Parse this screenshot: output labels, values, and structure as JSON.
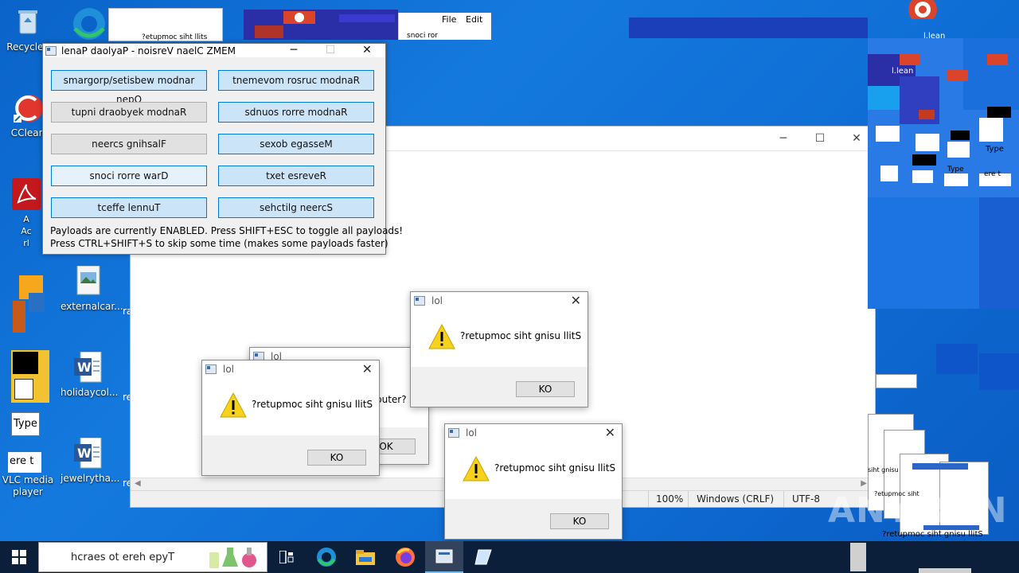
{
  "desktop": {
    "icons": [
      {
        "label": "Recycle I"
      },
      {
        "label": "CClean"
      },
      {
        "label": "A\nAc\nrl"
      },
      {
        "label": "externalcar..."
      },
      {
        "label": "holidaycol..."
      },
      {
        "label": "jewelrytha..."
      },
      {
        "label": "VLC media player"
      }
    ],
    "fragments": {
      "type1": "Type",
      "here1": "ere t",
      "ra": "ra",
      "re1": "re",
      "re2": "re"
    }
  },
  "notepad_bg": {
    "menu_file": "File",
    "menu_edit": "Edit",
    "status_zoom": "100%",
    "status_eol": "Windows (CRLF)",
    "status_enc": "UTF-8"
  },
  "panel": {
    "title": "lenaP daolyaP - noisreV naelC ZMEM",
    "buttons": [
      {
        "label": "smargorp/setisbew modnar nepO",
        "style": "blue"
      },
      {
        "label": "tnemevom rosruc modnaR",
        "style": "blue"
      },
      {
        "label": "tupni draobyek modnaR",
        "style": "gray"
      },
      {
        "label": "sdnuos rorre modnaR",
        "style": "blue"
      },
      {
        "label": "neercs gnihsalF",
        "style": "gray"
      },
      {
        "label": "sexob egasseM",
        "style": "blue"
      },
      {
        "label": "snoci rorre warD",
        "style": "light"
      },
      {
        "label": "txet esreveR",
        "style": "blue"
      },
      {
        "label": "tceffe lennuT",
        "style": "blue"
      },
      {
        "label": "sehctilg neercS",
        "style": "blue"
      }
    ],
    "info1": "Payloads are currently ENABLED. Press SHIFT+ESC to toggle all payloads!",
    "info2": "Press CTRL+SHIFT+S to skip some time (makes some payloads faster)"
  },
  "messages": {
    "back": {
      "title": "lol",
      "partial_text": "puter?",
      "ok": "OK"
    },
    "left": {
      "title": "lol",
      "text": "?retupmoc siht gnisu llitS",
      "ok": "KO"
    },
    "top": {
      "title": "lol",
      "text": "?retupmoc siht gnisu llitS",
      "ok": "KO"
    },
    "right": {
      "title": "lol",
      "text": "?retupmoc siht gnisu llitS",
      "ok": "KO"
    }
  },
  "glitch_text": {
    "tiny_title": "?etupmoc siht llits",
    "snoci": "snoci ror",
    "lean1": "l.lean",
    "lean2": "l.lean",
    "type2": "Type",
    "type3": "Type",
    "here2": "ere t",
    "bottom_right": "?retupmoc siht gnisu llitS",
    "br_small1": "?etupmoc siht",
    "br_small2": "siht gnisu"
  },
  "taskbar": {
    "search_placeholder": "hcraes ot ereh epyT"
  },
  "watermark": "ANY.RUN",
  "colors": {
    "desktop_blue": "#0f6fd6",
    "button_blue": "#cce4f7",
    "taskbar": "#0b1f3a",
    "warning_yellow": "#f7d21c"
  }
}
